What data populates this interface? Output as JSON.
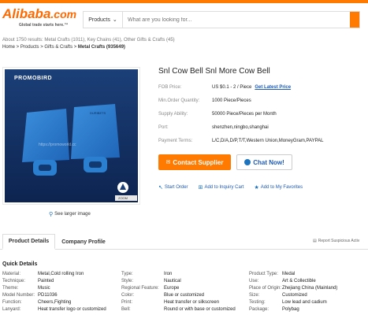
{
  "header": {
    "logo_text": "Alibaba",
    "logo_suffix": ".com",
    "logo_tagline": "Global trade starts here.™",
    "search_category": "Products",
    "search_placeholder": "What are you looking for..."
  },
  "results": {
    "prefix": "About 1750 results:",
    "links": [
      "Metal Crafts (1011)",
      "Key Chains (41)",
      "Other Gifts & Crafts (45)"
    ]
  },
  "breadcrumb": {
    "items": [
      "Home",
      "Products",
      "Gifts & Crafts",
      "Metal Crafts (935649)"
    ],
    "separator": " > "
  },
  "product": {
    "title": "Snl Cow Bell Snl More Cow Bell",
    "image_logo_text": "PROMOBIRD",
    "image_watermark": "https://promoworld.cc",
    "image_bell_text": "DURIBETS",
    "image_zoom_label": "ZOOM",
    "see_larger": "See larger image",
    "fob_label": "FOB Price:",
    "fob_value": "US $0.1 - 2 / Piece",
    "fob_link": "Get Latest Price",
    "moq_label": "Min.Order Quantity:",
    "moq_value": "1000 Piece/Pieces",
    "supply_label": "Supply Ability:",
    "supply_value": "50000 Piece/Pieces per Month",
    "port_label": "Port:",
    "port_value": "shenzhen,ningbo,shanghai",
    "payment_label": "Payment Terms:",
    "payment_value": "L/C,D/A,D/P,T/T,Western Union,MoneyGram,PAYPAL",
    "contact_button": "Contact Supplier",
    "chat_button": "Chat Now!",
    "start_order": "Start Order",
    "add_inquiry": "Add to Inquiry Cart",
    "add_favorites": "Add to My Favorites"
  },
  "tabs": {
    "details": "Product Details",
    "company": "Company Profile",
    "report": "Report Suspicious Activ"
  },
  "quick_details": {
    "title": "Quick Details",
    "rows": [
      [
        "Material:",
        "Metal,Cold rolling Iron",
        "Type:",
        "Iron",
        "Product Type:",
        "Medal"
      ],
      [
        "Technique:",
        "Painted",
        "Style:",
        "Nautical",
        "Use:",
        "Art & Collectible"
      ],
      [
        "Theme:",
        "Music",
        "Regional Feature:",
        "Europe",
        "Place of Origin:",
        "Zhejiang China (Mainland)"
      ],
      [
        "Model Number:",
        "PD11036",
        "Color:",
        "Blue or customized",
        "Size:",
        "Customized"
      ],
      [
        "Function:",
        "Cheers,Fighting",
        "Print:",
        "Heat transfer or silkscreen",
        "Testing:",
        "Low lead and cadium"
      ],
      [
        "Lanyard:",
        "Heat transfer logo or customized",
        "Bell:",
        "Round or with base or customized",
        "Package:",
        "Polybag"
      ]
    ]
  },
  "colors": {
    "brand_orange": "#ff7a00",
    "link_blue": "#1e5bb4",
    "bell_blue": "#2b78c9"
  }
}
